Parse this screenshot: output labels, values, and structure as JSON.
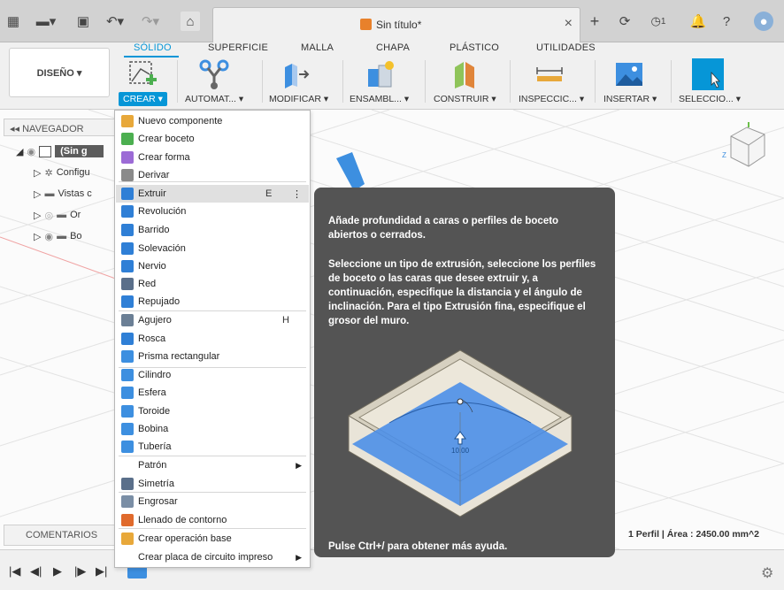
{
  "doc": {
    "title": "Sin título*",
    "notification_count": "1"
  },
  "ribbon": {
    "tabs": [
      "SÓLIDO",
      "SUPERFICIE",
      "MALLA",
      "CHAPA",
      "PLÁSTICO",
      "UTILIDADES"
    ],
    "design_button": "DISEÑO ▾",
    "groups": [
      "CREAR ▾",
      "AUTOMAT... ▾",
      "MODIFICAR ▾",
      "ENSAMBL... ▾",
      "CONSTRUIR ▾",
      "INSPECCIC... ▾",
      "INSERTAR ▾",
      "SELECCIO... ▾"
    ]
  },
  "navigator": {
    "title": "NAVEGADOR",
    "items": [
      "(Sin g",
      "Configu",
      "Vistas c",
      "Or",
      "Bo"
    ]
  },
  "comments_label": "COMENTARIOS",
  "menu": {
    "items": [
      {
        "label": "Nuevo componente",
        "shortcut": "",
        "color": "#e8a83a"
      },
      {
        "label": "Crear boceto",
        "shortcut": "",
        "color": "#4caf50"
      },
      {
        "label": "Crear forma",
        "shortcut": "",
        "color": "#9c6bd6"
      },
      {
        "label": "Derivar",
        "shortcut": "",
        "color": "#8a8a8a"
      },
      {
        "label": "Extruir",
        "shortcut": "E",
        "color": "#2f7fd6"
      },
      {
        "label": "Revolución",
        "shortcut": "",
        "color": "#2f7fd6"
      },
      {
        "label": "Barrido",
        "shortcut": "",
        "color": "#2f7fd6"
      },
      {
        "label": "Solevación",
        "shortcut": "",
        "color": "#2f7fd6"
      },
      {
        "label": "Nervio",
        "shortcut": "",
        "color": "#2f7fd6"
      },
      {
        "label": "Red",
        "shortcut": "",
        "color": "#5a6f8a"
      },
      {
        "label": "Repujado",
        "shortcut": "",
        "color": "#2f7fd6"
      },
      {
        "label": "Agujero",
        "shortcut": "H",
        "color": "#6b7f95"
      },
      {
        "label": "Rosca",
        "shortcut": "",
        "color": "#2f7fd6"
      },
      {
        "label": "Prisma rectangular",
        "shortcut": "",
        "color": "#3d8fe0"
      },
      {
        "label": "Cilindro",
        "shortcut": "",
        "color": "#3d8fe0"
      },
      {
        "label": "Esfera",
        "shortcut": "",
        "color": "#3d8fe0"
      },
      {
        "label": "Toroide",
        "shortcut": "",
        "color": "#3d8fe0"
      },
      {
        "label": "Bobina",
        "shortcut": "",
        "color": "#3d8fe0"
      },
      {
        "label": "Tubería",
        "shortcut": "",
        "color": "#3d8fe0"
      },
      {
        "label": "Patrón",
        "shortcut": "",
        "color": ""
      },
      {
        "label": "Simetría",
        "shortcut": "",
        "color": "#5a6f8a"
      },
      {
        "label": "Engrosar",
        "shortcut": "",
        "color": "#7a8ea5"
      },
      {
        "label": "Llenado de contorno",
        "shortcut": "",
        "color": "#e06a2c"
      },
      {
        "label": "Crear operación base",
        "shortcut": "",
        "color": "#e8a83a"
      },
      {
        "label": "Crear placa de circuito impreso",
        "shortcut": "",
        "color": ""
      }
    ]
  },
  "tooltip": {
    "p1": "Añade profundidad a caras o perfiles de boceto abiertos o cerrados.",
    "p2": "Seleccione un tipo de extrusión, seleccione los perfiles de boceto o las caras que desee extruir y, a continuación, especifique la distancia y el ángulo de inclinación. Para el tipo Extrusión fina, especifique el grosor del muro.",
    "dimension": "10.00",
    "footer": "Pulse Ctrl+/ para obtener más ayuda."
  },
  "status": "1 Perfil | Área : 2450.00 mm^2"
}
